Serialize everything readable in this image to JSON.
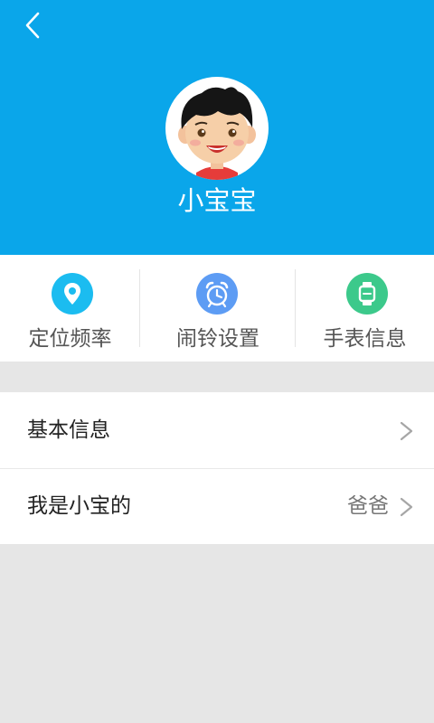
{
  "header": {
    "background": "#0aa6ea",
    "back_icon": "chevron-left-icon",
    "profile_name": "小宝宝"
  },
  "quick_actions": [
    {
      "label": "定位频率",
      "icon": "location-pin-icon",
      "color": "#1bbcf0"
    },
    {
      "label": "闹铃设置",
      "icon": "alarm-clock-icon",
      "color": "#5d9cf4"
    },
    {
      "label": "手表信息",
      "icon": "watch-icon",
      "color": "#3cc98b"
    }
  ],
  "list": [
    {
      "label": "基本信息",
      "value": ""
    },
    {
      "label": "我是小宝的",
      "value": "爸爸"
    }
  ]
}
